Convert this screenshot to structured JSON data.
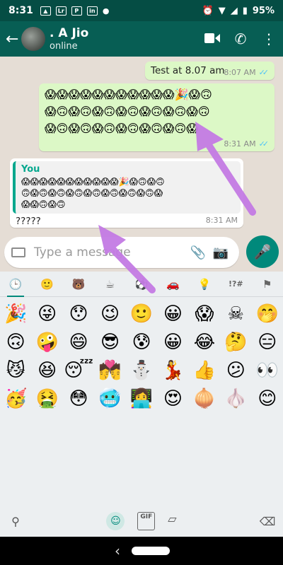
{
  "status_bar": {
    "time": "8:31",
    "battery": "95%",
    "icons": [
      "image-icon",
      "lr-icon",
      "p-icon",
      "in-icon",
      "dot-icon"
    ]
  },
  "header": {
    "contact_name": ". A Jio",
    "contact_status": "online"
  },
  "messages": [
    {
      "type": "outgoing",
      "text": "Test at 8.07 am",
      "time": "8:07 AM"
    },
    {
      "type": "outgoing-emoji",
      "time": "8:31 AM",
      "rows": [
        "😱😱😱😱😱😱😱😱😱😱😱🎉😱🙃",
        "😱🙃😱🙃😱🙃😱🙃😱🙃😱🙃😱🙃",
        "😱🙃😱🙃😱🙃😱🙃😱🙃😱🙃😱"
      ]
    },
    {
      "type": "incoming-reply",
      "quote_author": "You",
      "text": "?????",
      "time": "8:31 AM",
      "quote_rows": [
        "😱😱😱😱😱😱😱😱😱😱😱🎉😱🙃😱🙃",
        "🙃😱🙃😱🙃😱🙃😱🙃😱🙃😱🙃😱🙃😱",
        "😱😱🙃😱🙃"
      ]
    }
  ],
  "composer": {
    "placeholder": "Type a message"
  },
  "keyboard": {
    "categories": [
      "🕒",
      "🙂",
      "🐻",
      "☕",
      "⚽",
      "🚗",
      "💡",
      "!?#",
      "⚑"
    ],
    "emoji_rows": [
      [
        "🎉",
        "😜",
        "😯",
        "😉",
        "🙂",
        "😀",
        "😱",
        "☠",
        "🤭"
      ],
      [
        "🙃",
        "🤪",
        "😄",
        "😎",
        "😰",
        "😀",
        "😂",
        "🤔",
        "😑"
      ],
      [
        "😼",
        "😆",
        "😴",
        "💏",
        "⛄",
        "💃",
        "👍",
        "😕",
        "👀"
      ],
      [
        "🥳",
        "🤮",
        "😳",
        "🥶",
        "👩‍💻",
        "😍",
        "🧅",
        "🧄",
        "😊"
      ]
    ],
    "bottom": {
      "search": "⚲",
      "emoji": "☺",
      "gif": "GIF",
      "sticker": "▱",
      "backspace": "⌫"
    }
  },
  "colors": {
    "header": "#075e54",
    "status": "#054d44",
    "outgoing": "#dcf8c6",
    "accent": "#00897b",
    "arrow": "#c47be4"
  }
}
